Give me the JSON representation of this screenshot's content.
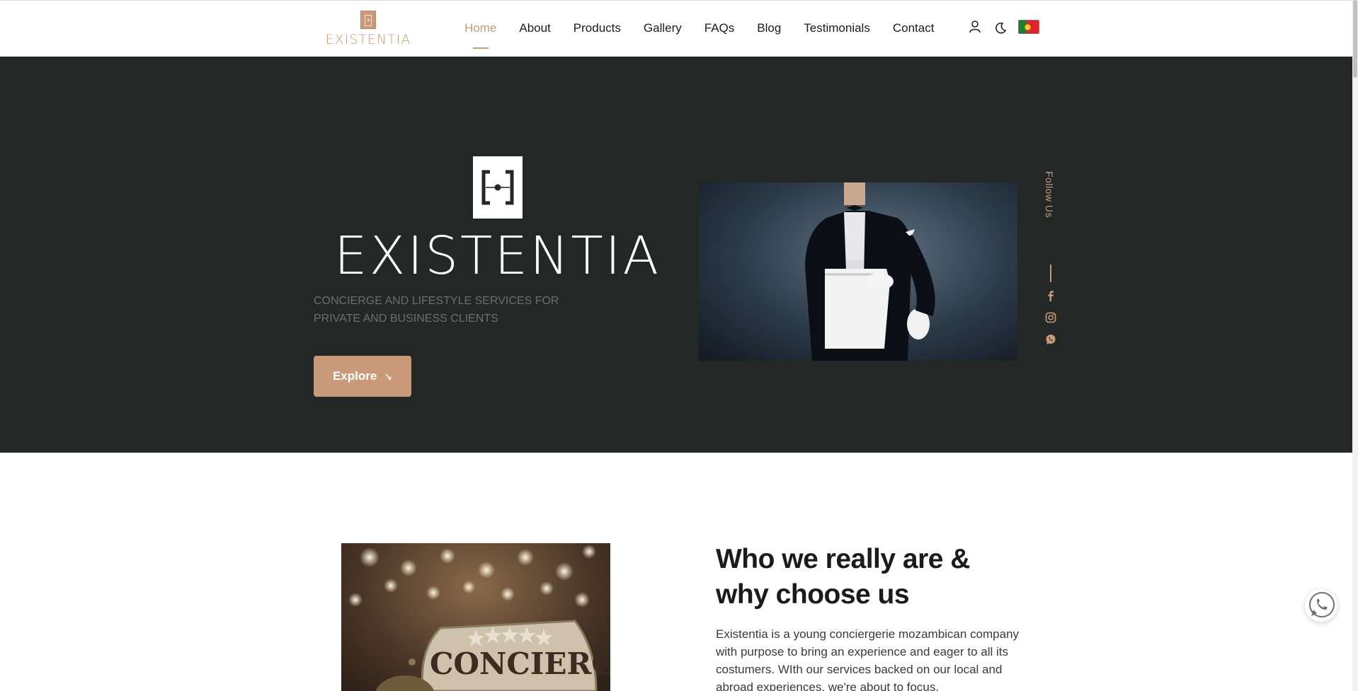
{
  "brand": {
    "name": "EXISTENTIA",
    "accent": "#c9997a",
    "dark": "#232726"
  },
  "nav": {
    "items": [
      {
        "label": "Home",
        "active": true
      },
      {
        "label": "About",
        "active": false
      },
      {
        "label": "Products",
        "active": false
      },
      {
        "label": "Gallery",
        "active": false
      },
      {
        "label": "FAQs",
        "active": false
      },
      {
        "label": "Blog",
        "active": false
      },
      {
        "label": "Testimonials",
        "active": false
      },
      {
        "label": "Contact",
        "active": false
      }
    ],
    "icons": [
      "user-icon",
      "moon-icon",
      "portugal-flag-icon"
    ]
  },
  "hero": {
    "wordmark": "EXISTENTIA",
    "tagline": "CONCIERGE AND LIFESTYLE SERVICES FOR PRIVATE AND BUSINESS CLIENTS",
    "explore_label": "Explore",
    "explore_icon": "arrow-down-right-icon",
    "follow_label": "Follow Us",
    "social_icons": [
      "facebook-icon",
      "instagram-icon",
      "whatsapp-icon"
    ]
  },
  "about": {
    "title": "Who we really are & why choose us",
    "text": "Existentia is a young conciergerie mozambican company with purpose to bring an experience and eager to all its costumers. WIth our services backed on our local and abroad experiences, we're about to focus.",
    "image_sign": "CONCIERGE"
  },
  "floating": {
    "icon": "whatsapp-chat-icon"
  }
}
